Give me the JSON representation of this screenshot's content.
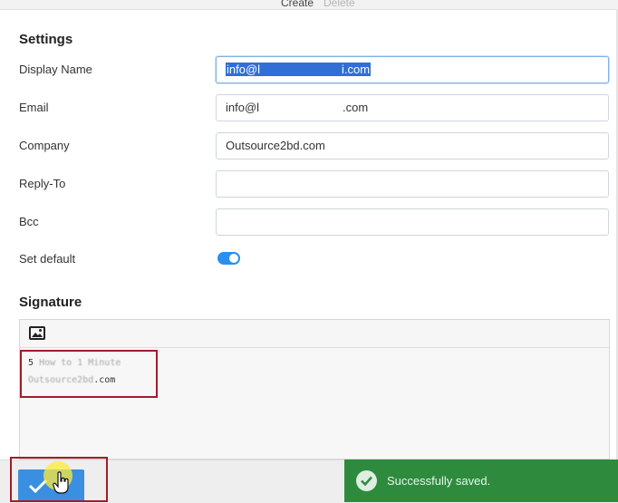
{
  "top_tabs": {
    "create": "Create",
    "delete": "Delete"
  },
  "settings": {
    "title": "Settings",
    "display_name": {
      "label": "Display Name",
      "value_prefix": "info@l",
      "value_suffix": "i.com"
    },
    "email": {
      "label": "Email",
      "value_prefix": "info@l",
      "value_suffix": ".com"
    },
    "company": {
      "label": "Company",
      "value": "Outsource2bd.com"
    },
    "reply_to": {
      "label": "Reply-To",
      "value": ""
    },
    "bcc": {
      "label": "Bcc",
      "value": ""
    },
    "set_default": {
      "label": "Set default",
      "on": true
    }
  },
  "signature": {
    "title": "Signature",
    "toolbar_icon": "image-icon",
    "line1_prefix": "5",
    "line1_blurred": "How to 1 Minute",
    "line2_blurred": "Outsource2bd",
    "line2_suffix": ".com"
  },
  "save_button": {
    "icon": "checkmark-icon"
  },
  "toast": {
    "icon": "check-circle-icon",
    "message": "Successfully saved.",
    "color": "#2e8b3e"
  },
  "colors": {
    "accent": "#3b8fe0",
    "highlight_border": "#a11c2b"
  }
}
